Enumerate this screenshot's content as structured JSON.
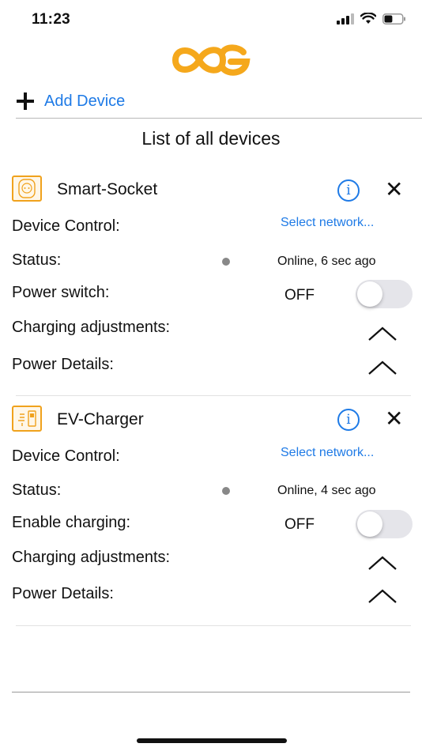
{
  "status_bar": {
    "time": "11:23",
    "battery_level": 0.45
  },
  "header": {
    "add_device_label": "Add Device",
    "logo_icon": "brand-logo-icon"
  },
  "list_title": "List of all devices",
  "devices": [
    {
      "name": "Smart-Socket",
      "icon": "smart-socket-icon",
      "control_label": "Device Control:",
      "control_value": "Select network...",
      "status_label": "Status:",
      "status_value": "Online, 6 sec ago",
      "switch_label": "Power switch:",
      "switch_state": "OFF",
      "adjust_label": "Charging adjustments:",
      "details_label": "Power Details:"
    },
    {
      "name": "EV-Charger",
      "icon": "ev-charger-icon",
      "control_label": "Device Control:",
      "control_value": "Select network...",
      "status_label": "Status:",
      "status_value": "Online, 4 sec ago",
      "switch_label": "Enable charging:",
      "switch_state": "OFF",
      "adjust_label": "Charging adjustments:",
      "details_label": "Power Details:"
    }
  ],
  "colors": {
    "accent": "#1e7ae6",
    "brand": "#f5a81c",
    "status_dot": "#888888"
  }
}
